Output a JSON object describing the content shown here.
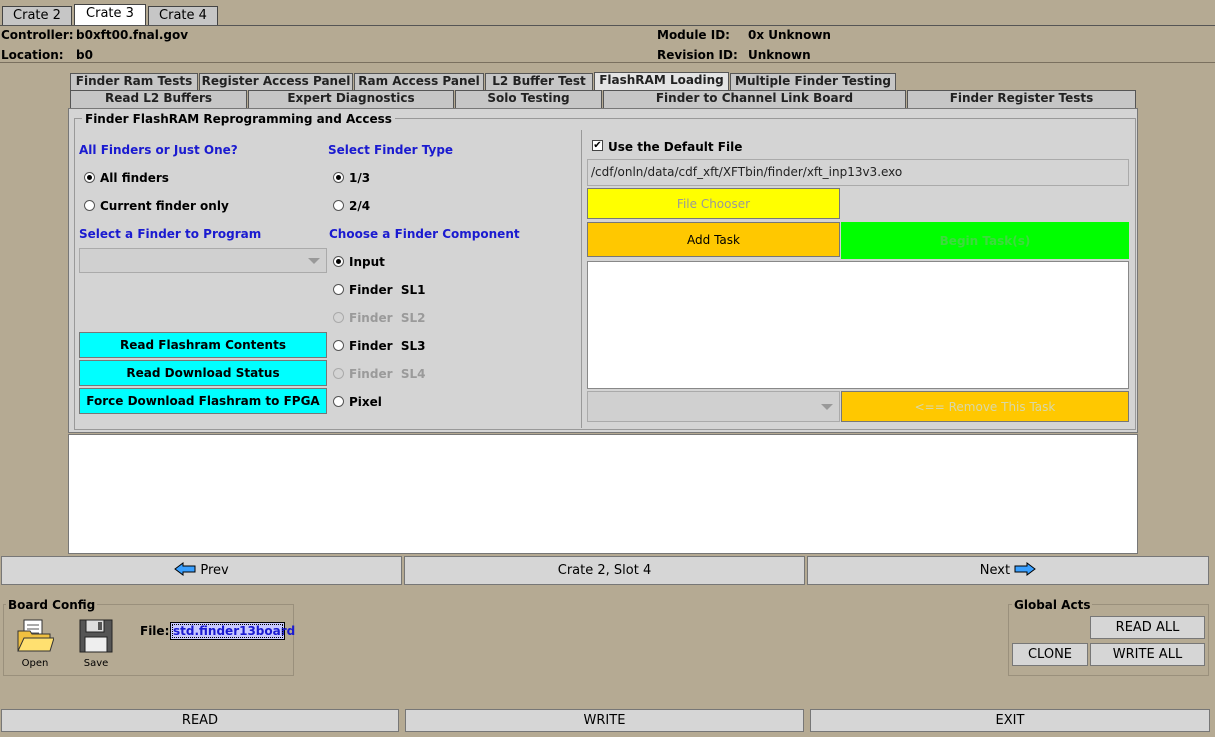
{
  "crate_tabs": [
    "Crate 2",
    "Crate 3",
    "Crate 4"
  ],
  "info": {
    "controller_label": "Controller:",
    "controller_value": "b0xft00.fnal.gov",
    "location_label": "Location:",
    "location_value": "b0",
    "module_label": "Module ID:",
    "module_value": "0x Unknown",
    "revision_label": "Revision ID:",
    "revision_value": "Unknown"
  },
  "tabs_row1": [
    "Finder Ram Tests",
    "Register Access Panel",
    "Ram Access Panel",
    "L2 Buffer Test",
    "FlashRAM Loading",
    "Multiple Finder Testing"
  ],
  "tabs_row2": [
    "Read L2 Buffers",
    "Expert Diagnostics",
    "Solo Testing",
    "Finder to Channel Link Board",
    "Finder Register Tests"
  ],
  "panel": {
    "title": "Finder FlashRAM Reprogramming and Access",
    "finders_heading": "All Finders or Just One?",
    "all_finders": "All finders",
    "current_finder": "Current finder only",
    "type_heading": "Select Finder Type",
    "type_1_3": "1/3",
    "type_2_4": "2/4",
    "select_finder_heading": "Select a Finder to Program",
    "component_heading": "Choose a Finder Component",
    "components": [
      "Input",
      "Finder  SL1",
      "Finder  SL2",
      "Finder  SL3",
      "Finder  SL4",
      "Pixel"
    ],
    "read_flashram": "Read Flashram Contents",
    "read_download": "Read Download Status",
    "force_download": "Force Download Flashram to FPGA",
    "use_default": "Use the Default File",
    "file_path": "/cdf/onln/data/cdf_xft/XFTbin/finder/xft_inp13v3.exo",
    "file_chooser": "File Chooser",
    "add_task": "Add Task",
    "begin_tasks": "Begin Task(s)",
    "remove_task": "<== Remove This Task"
  },
  "colors": {
    "yellow": "#ffff00",
    "orange": "#ffc800",
    "green": "#00ff00",
    "cyan": "#00ffff",
    "background": "#b5aa93"
  },
  "nav": {
    "prev": "Prev",
    "slot": "Crate 2, Slot 4",
    "next": "Next"
  },
  "board_config": {
    "title": "Board Config",
    "file_label": "File:",
    "file_value": "std.finder13board",
    "open": "Open",
    "save": "Save"
  },
  "global_acts": {
    "title": "Global Acts",
    "read_all": "READ ALL",
    "clone": "CLONE",
    "write_all": "WRITE ALL"
  },
  "bottom": {
    "read": "READ",
    "write": "WRITE",
    "exit": "EXIT"
  }
}
